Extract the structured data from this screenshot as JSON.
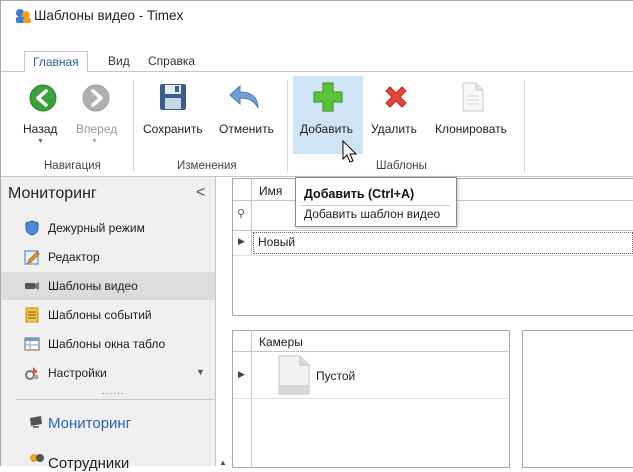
{
  "window": {
    "title": "Шаблоны видео - Timex "
  },
  "ribbon": {
    "tabs": [
      {
        "label": "Главная",
        "active": true
      },
      {
        "label": "Вид"
      },
      {
        "label": "Справка"
      }
    ],
    "buttons": {
      "back": "Назад",
      "forward": "Вперед",
      "save": "Сохранить",
      "cancel": "Отменить",
      "add": "Добавить",
      "delete": "Удалить",
      "clone": "Клонировать"
    },
    "groups": {
      "navigation": "Навигация",
      "changes": "Изменения",
      "templates": "Шаблоны"
    }
  },
  "nav": {
    "header": "Мониторинг",
    "collapse_glyph": "<",
    "items": [
      {
        "label": "Дежурный режим",
        "icon": "shield-icon"
      },
      {
        "label": "Редактор",
        "icon": "edit-icon"
      },
      {
        "label": "Шаблоны видео",
        "icon": "camera-icon",
        "selected": true
      },
      {
        "label": "Шаблоны событий",
        "icon": "events-icon"
      },
      {
        "label": "Шаблоны окна табло",
        "icon": "board-icon"
      },
      {
        "label": "Настройки",
        "icon": "settings-icon"
      }
    ],
    "grip": "......",
    "big_items": [
      {
        "label": "Мониторинг",
        "icon": "monitor-icon"
      },
      {
        "label": "Сотрудники",
        "icon": "people-icon"
      }
    ]
  },
  "templates_grid": {
    "column_header": "Имя",
    "rows": [
      {
        "name": "Новый"
      }
    ]
  },
  "cameras_grid": {
    "column_header": "Камеры",
    "rows": [
      {
        "name": "Пустой"
      }
    ]
  },
  "tooltip": {
    "title": "Добавить (Ctrl+A)",
    "description": "Добавить шаблон видео"
  },
  "colors": {
    "accent": "#2a62b8",
    "hover": "#cfe5f6",
    "nav_background": "#f0f0f0",
    "selection": "#dcdcdc"
  }
}
